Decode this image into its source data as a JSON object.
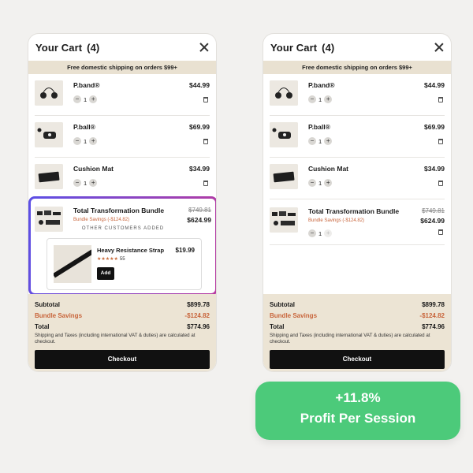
{
  "left": {
    "title": "Your Cart",
    "count": "(4)",
    "shipping": "Free domestic shipping on orders $99+",
    "items": [
      {
        "name": "P.band®",
        "price": "$44.99",
        "qty": "1"
      },
      {
        "name": "P.ball®",
        "price": "$69.99",
        "qty": "1"
      },
      {
        "name": "Cushion Mat",
        "price": "$34.99",
        "qty": "1"
      },
      {
        "name": "Total Transformation Bundle",
        "original_price": "$749.81",
        "price": "$624.99",
        "savings": "Bundle Savings (-$124.82)"
      }
    ],
    "upsell": {
      "heading": "OTHER CUSTOMERS ADDED",
      "name": "Heavy Resistance Strap",
      "price": "$19.99",
      "stars": "★★★★★",
      "reviews": "55",
      "add": "Add"
    },
    "summary": {
      "subtotal_label": "Subtotal",
      "subtotal": "$899.78",
      "savings_label": "Bundle Savings",
      "savings": "-$124.82",
      "total_label": "Total",
      "total": "$774.96",
      "note": "Shipping and Taxes (including international VAT & duties) are calculated at checkout.",
      "checkout": "Checkout"
    }
  },
  "right": {
    "title": "Your Cart",
    "count": "(4)",
    "shipping": "Free domestic shipping on orders $99+",
    "items": [
      {
        "name": "P.band®",
        "price": "$44.99",
        "qty": "1"
      },
      {
        "name": "P.ball®",
        "price": "$69.99",
        "qty": "1"
      },
      {
        "name": "Cushion Mat",
        "price": "$34.99",
        "qty": "1"
      },
      {
        "name": "Total Transformation Bundle",
        "original_price": "$749.81",
        "price": "$624.99",
        "savings": "Bundle Savings (-$124.82)",
        "qty": "1"
      }
    ],
    "summary": {
      "subtotal_label": "Subtotal",
      "subtotal": "$899.78",
      "savings_label": "Bundle Savings",
      "savings": "-$124.82",
      "total_label": "Total",
      "total": "$774.96",
      "note": "Shipping and Taxes (including international VAT & duties) are calculated at checkout.",
      "checkout": "Checkout"
    }
  },
  "metric": {
    "value": "+11.8%",
    "label": "Profit Per Session"
  },
  "colors": {
    "accent_green": "#4cca7a",
    "savings": "#c8643a",
    "highlight_start": "#5b4fe6",
    "highlight_end": "#b83aa0"
  }
}
